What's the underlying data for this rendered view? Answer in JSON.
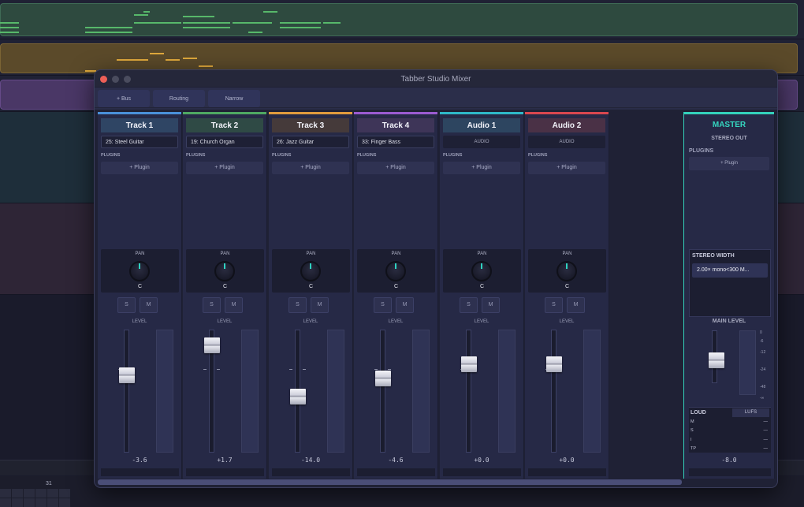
{
  "window": {
    "title": "Tabber Studio Mixer",
    "traffic_lights": [
      "#ee5f57",
      "#4a4c5e",
      "#4a4c5e"
    ]
  },
  "toolbar": {
    "bus_label": "+ Bus",
    "routing_label": "Routing",
    "narrow_label": "Narrow"
  },
  "background": {
    "ruler_number": "31"
  },
  "channels": [
    {
      "name": "Track 1",
      "color": "#4a90d9",
      "name_bg": "#2f4564",
      "instrument": "25: Steel Guitar",
      "type": "midi",
      "plugins_label": "PLUGINS",
      "plugin_button": "+ Plugin",
      "pan_label": "PAN",
      "pan_value": "C",
      "solo": "S",
      "mute": "M",
      "level_label": "LEVEL",
      "level": "-3.6",
      "fader_pos": 0.35
    },
    {
      "name": "Track 2",
      "color": "#4fa862",
      "name_bg": "#2f4a45",
      "instrument": "19: Church Organ",
      "type": "midi",
      "plugins_label": "PLUGINS",
      "plugin_button": "+ Plugin",
      "pan_label": "PAN",
      "pan_value": "C",
      "solo": "S",
      "mute": "M",
      "level_label": "LEVEL",
      "level": "+1.7",
      "fader_pos": 0.07
    },
    {
      "name": "Track 3",
      "color": "#e09b3d",
      "name_bg": "#453a3a",
      "instrument": "26: Jazz Guitar",
      "type": "midi",
      "plugins_label": "PLUGINS",
      "plugin_button": "+ Plugin",
      "pan_label": "PAN",
      "pan_value": "C",
      "solo": "S",
      "mute": "M",
      "level_label": "LEVEL",
      "level": "-14.0",
      "fader_pos": 0.55
    },
    {
      "name": "Track 4",
      "color": "#9b5bd1",
      "name_bg": "#3e3558",
      "instrument": "33: Finger Bass",
      "type": "midi",
      "plugins_label": "PLUGINS",
      "plugin_button": "+ Plugin",
      "pan_label": "PAN",
      "pan_value": "C",
      "solo": "S",
      "mute": "M",
      "level_label": "LEVEL",
      "level": "-4.6",
      "fader_pos": 0.38
    },
    {
      "name": "Audio 1",
      "color": "#2fb8c8",
      "name_bg": "#2d4560",
      "instrument": "AUDIO",
      "type": "audio",
      "plugins_label": "PLUGINS",
      "plugin_button": "+ Plugin",
      "pan_label": "PAN",
      "pan_value": "C",
      "solo": "S",
      "mute": "M",
      "level_label": "LEVEL",
      "level": "+0.0",
      "fader_pos": 0.25
    },
    {
      "name": "Audio 2",
      "color": "#d9474f",
      "name_bg": "#4a3146",
      "instrument": "AUDIO",
      "type": "audio",
      "plugins_label": "PLUGINS",
      "plugin_button": "+ Plugin",
      "pan_label": "PAN",
      "pan_value": "C",
      "solo": "S",
      "mute": "M",
      "level_label": "LEVEL",
      "level": "+0.0",
      "fader_pos": 0.25
    }
  ],
  "master": {
    "title": "MASTER",
    "output": "STEREO OUT",
    "plugins_label": "PLUGINS",
    "plugin_button": "+ Plugin",
    "stereo_width_label": "STEREO WIDTH",
    "stereo_width_value": "2.00× mono<300 M...",
    "main_level_label": "MAIN LEVEL",
    "meter_scale": [
      "0",
      "-6",
      "-12",
      "-24",
      "-48",
      "-∞"
    ],
    "loudness_label": "LOUD",
    "lufs_label": "LUFS",
    "loudness_rows": [
      {
        "label": "M",
        "value": "—"
      },
      {
        "label": "S",
        "value": "—"
      },
      {
        "label": "I",
        "value": "—"
      },
      {
        "label": "TP",
        "value": "—"
      }
    ],
    "level": "-8.0",
    "fader_pos": 0.6,
    "accent": "#34d1bb"
  }
}
